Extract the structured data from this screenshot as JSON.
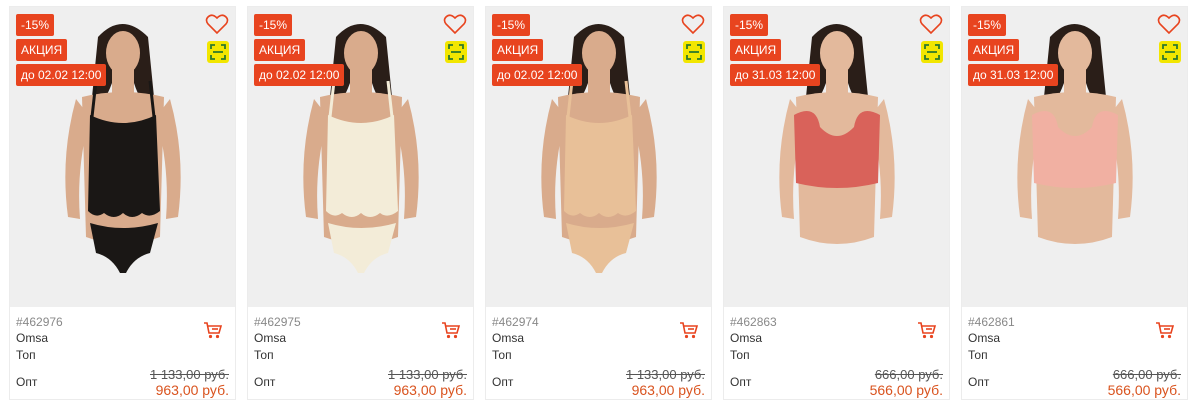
{
  "colors": {
    "accent": "#e8441f",
    "price": "#d9531e",
    "scan_bg": "#f2e600"
  },
  "products": [
    {
      "sku": "#462976",
      "brand": "Omsa",
      "type": "Топ",
      "discount": "-15%",
      "promo": "АКЦИЯ",
      "until": "до 02.02 12:00",
      "opt_label": "Опт",
      "old_price": "1 133,00 руб.",
      "new_price": "963,00 руб.",
      "garment_color": "#1a1715",
      "garment_style": "camisole",
      "skin": "#d9ab8c",
      "icons": [
        "heart-icon",
        "scan-icon",
        "cart-icon"
      ]
    },
    {
      "sku": "#462975",
      "brand": "Omsa",
      "type": "Топ",
      "discount": "-15%",
      "promo": "АКЦИЯ",
      "until": "до 02.02 12:00",
      "opt_label": "Опт",
      "old_price": "1 133,00 руб.",
      "new_price": "963,00 руб.",
      "garment_color": "#f3ecd8",
      "garment_style": "camisole",
      "skin": "#d9ab8c",
      "icons": [
        "heart-icon",
        "scan-icon",
        "cart-icon"
      ]
    },
    {
      "sku": "#462974",
      "brand": "Omsa",
      "type": "Топ",
      "discount": "-15%",
      "promo": "АКЦИЯ",
      "until": "до 02.02 12:00",
      "opt_label": "Опт",
      "old_price": "1 133,00 руб.",
      "new_price": "963,00 руб.",
      "garment_color": "#e8c098",
      "garment_style": "camisole",
      "skin": "#d9ab8c",
      "icons": [
        "heart-icon",
        "scan-icon",
        "cart-icon"
      ]
    },
    {
      "sku": "#462863",
      "brand": "Omsa",
      "type": "Топ",
      "discount": "-15%",
      "promo": "АКЦИЯ",
      "until": "до 31.03 12:00",
      "opt_label": "Опт",
      "old_price": "666,00 руб.",
      "new_price": "566,00 руб.",
      "garment_color": "#d9625a",
      "garment_style": "crop",
      "skin": "#e3b99c",
      "icons": [
        "heart-icon",
        "scan-icon",
        "cart-icon"
      ]
    },
    {
      "sku": "#462861",
      "brand": "Omsa",
      "type": "Топ",
      "discount": "-15%",
      "promo": "АКЦИЯ",
      "until": "до 31.03 12:00",
      "opt_label": "Опт",
      "old_price": "666,00 руб.",
      "new_price": "566,00 руб.",
      "garment_color": "#f1b0a2",
      "garment_style": "crop",
      "skin": "#e3b99c",
      "icons": [
        "heart-icon",
        "scan-icon",
        "cart-icon"
      ]
    }
  ]
}
